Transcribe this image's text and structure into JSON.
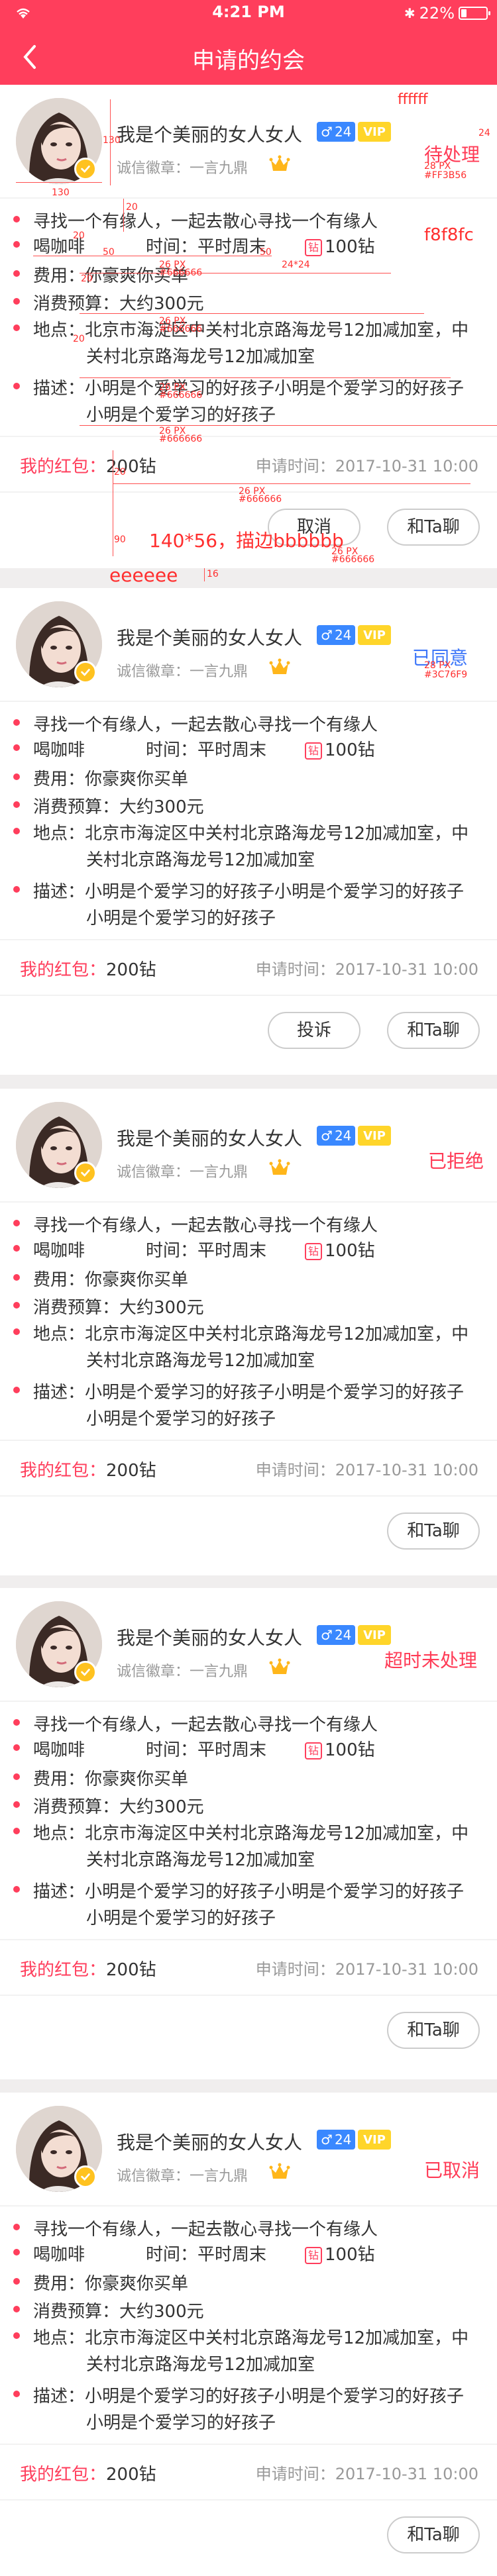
{
  "status_bar": {
    "time": "4:21 PM",
    "battery": "22%",
    "bluetooth": "✱",
    "battery_level": 0.22
  },
  "nav": {
    "title": "申请的约会",
    "back": "返回"
  },
  "profile": {
    "name": "我是个美丽的女人女人",
    "age": "24",
    "vip": "VIP",
    "medal": "诚信徽章：一言九鼎"
  },
  "info_labels": {
    "intent": "寻找一个有缘人，一起去散心寻找一个有缘人",
    "activity": "喝咖啡",
    "time": "时间：平时周末",
    "coins": "100钻",
    "fee": "费用：你豪爽你买单",
    "budget": "消费预算：大约300元",
    "address_1": "地点：北京市海淀区中关村北京路海龙号12加减加室，中",
    "address_2": "关村北京路海龙号12加减加室",
    "desc_1": "描述：小明是个爱学习的好孩子小明是个爱学习的好孩子",
    "desc_2": "小明是个爱学习的好孩子"
  },
  "footer": {
    "red_packet_label": "我的红包：",
    "red_packet_value": "200钻",
    "apply_time": "申请时间：2017-10-31  10:00"
  },
  "buttons": {
    "cancel": "取消",
    "chat": "和Ta聊",
    "complain": "投诉"
  },
  "cards": [
    {
      "status": "待处理",
      "status_color": "#ff3b56"
    },
    {
      "status": "已同意",
      "status_color": "#3c76f9"
    },
    {
      "status": "已拒绝",
      "status_color": "#ff3b56"
    },
    {
      "status": "超时未处理",
      "status_color": "#ff3b56"
    },
    {
      "status": "已取消",
      "status_color": "#ff3b56"
    }
  ],
  "annotations": {
    "ffffff": "ffffff",
    "f8f8fc": "f8f8fc",
    "eeeeee": "eeeeee",
    "btn_spec": "140*56，描边bbbbbb",
    "status_spec_1": "28 PX",
    "status_spec_2": "#FF3B56",
    "agreed_spec_1": "28 PX",
    "agreed_spec_2": "#3C76F9",
    "px26": "26 PX",
    "c666": "#666666",
    "n130": "130",
    "n20": "20",
    "n50": "50",
    "n24": "24",
    "n16": "16",
    "n90": "90",
    "n2424": "24*24"
  },
  "colors": {
    "primary": "#ff3e5c",
    "blue": "#3a88ff",
    "gold": "#ffc21f",
    "bg": "#f0eeee"
  }
}
